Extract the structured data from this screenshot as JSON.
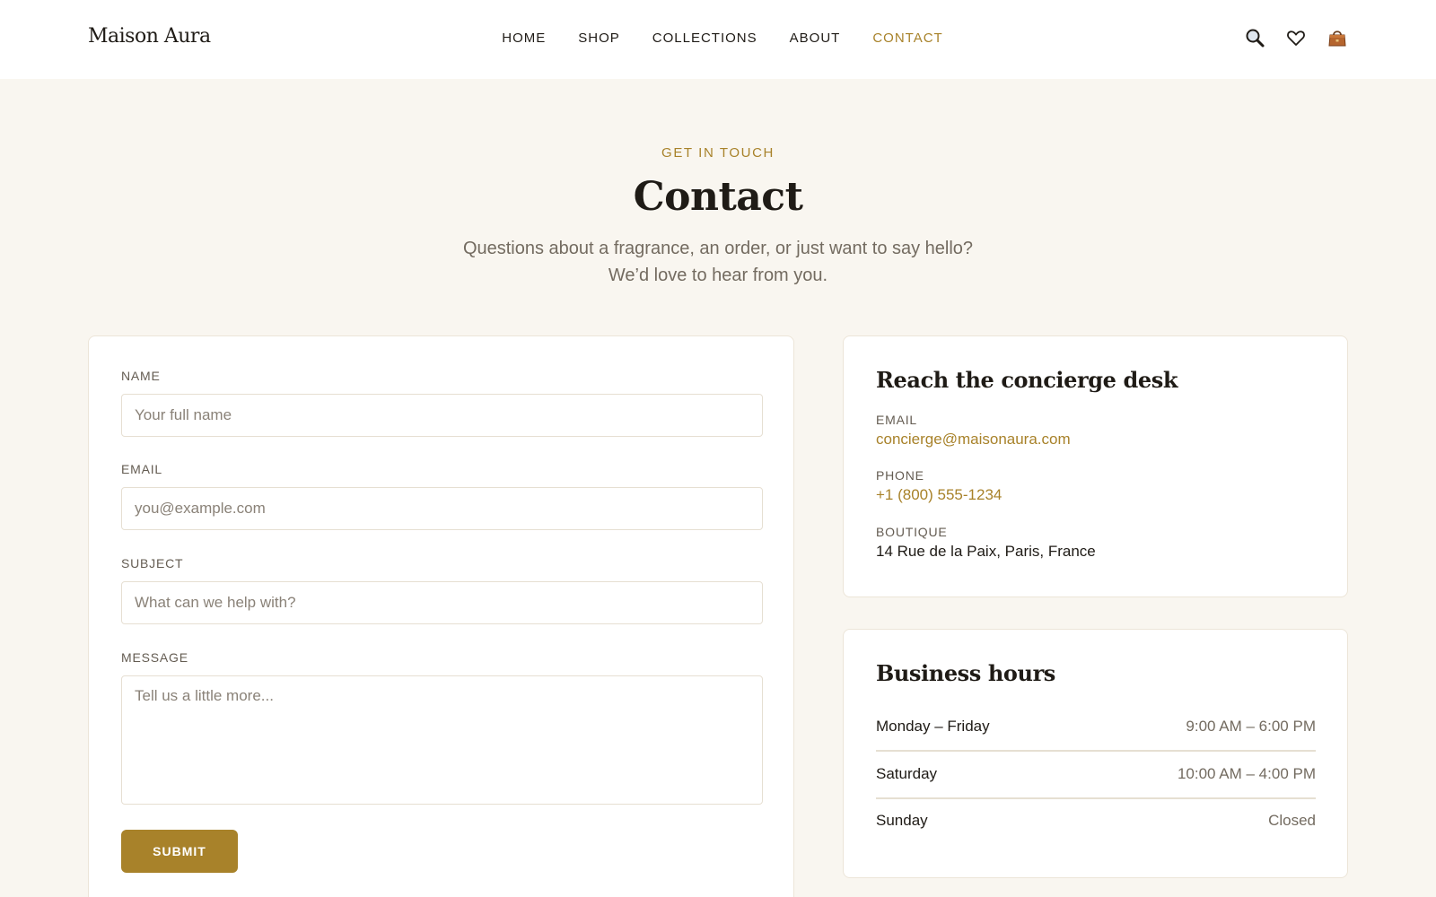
{
  "brand": "Maison Aura",
  "nav": [
    "HOME",
    "SHOP",
    "COLLECTIONS",
    "ABOUT",
    "CONTACT"
  ],
  "nav_active": "CONTACT",
  "header_icons": [
    "search-icon",
    "heart-icon",
    "bag-icon"
  ],
  "hero": {
    "eyebrow": "GET IN TOUCH",
    "title": "Contact",
    "subtitle_line1": "Questions about a fragrance, an order, or just want to say hello?",
    "subtitle_line2": "We’d love to hear from you."
  },
  "form": {
    "name_label": "NAME",
    "name_placeholder": "Your full name",
    "email_label": "EMAIL",
    "email_placeholder": "you@example.com",
    "subject_label": "SUBJECT",
    "subject_placeholder": "What can we help with?",
    "message_label": "MESSAGE",
    "message_placeholder": "Tell us a little more...",
    "submit_label": "SUBMIT"
  },
  "concierge": {
    "title": "Reach the concierge desk",
    "email_label": "EMAIL",
    "email_value": "concierge@maisonaura.com",
    "phone_label": "PHONE",
    "phone_value": "+1 (800) 555-1234",
    "boutique_label": "BOUTIQUE",
    "boutique_value": "14 Rue de la Paix, Paris, France"
  },
  "hours": {
    "title": "Business hours",
    "rows": [
      {
        "day": "Monday – Friday",
        "time": "9:00 AM – 6:00 PM"
      },
      {
        "day": "Saturday",
        "time": "10:00 AM – 4:00 PM"
      },
      {
        "day": "Sunday",
        "time": "Closed"
      }
    ]
  },
  "colors": {
    "accent": "#a8822a",
    "background": "#f9f6f0",
    "text": "#1f1b16",
    "muted": "#736b60"
  }
}
